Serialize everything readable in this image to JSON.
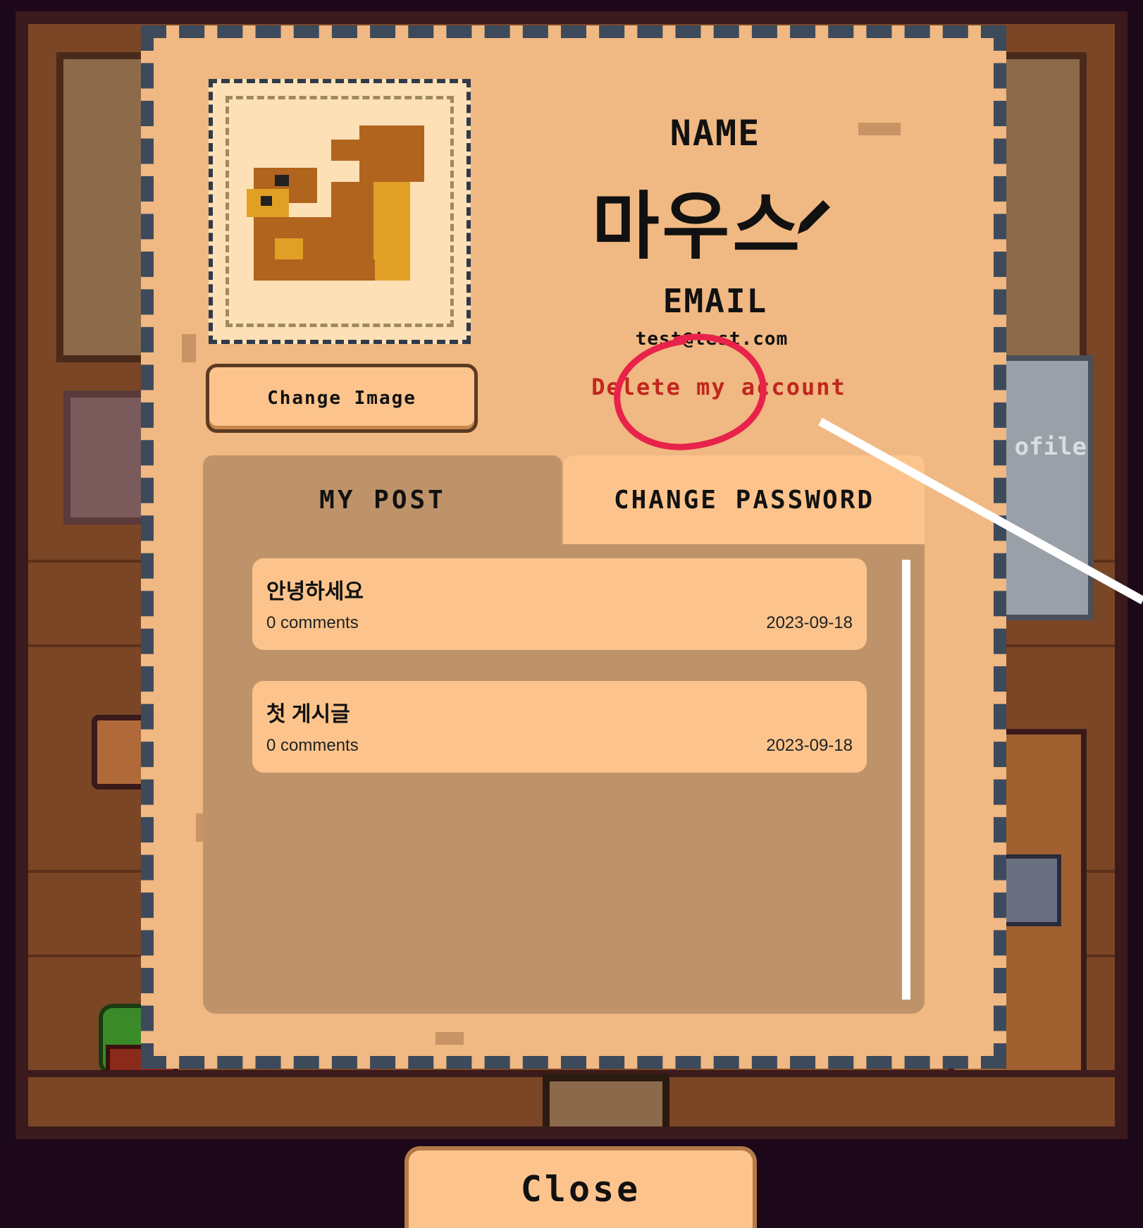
{
  "room": {
    "background_label": "ofile"
  },
  "profile": {
    "name_label": "NAME",
    "name_value": "마우스",
    "email_label": "EMAIL",
    "email_value": "test@test.com",
    "delete_account": "Delete my account",
    "change_image": "Change Image",
    "avatar_icon": "squirrel-icon"
  },
  "tabs": {
    "my_post": "MY POST",
    "change_password": "CHANGE PASSWORD"
  },
  "posts": [
    {
      "title": "안녕하세요",
      "comments": "0 comments",
      "date": "2023-09-18"
    },
    {
      "title": "첫 게시글",
      "comments": "0 comments",
      "date": "2023-09-18"
    }
  ],
  "footer": {
    "close": "Close"
  },
  "colors": {
    "parchment": "#f0b882",
    "tab_active": "#bf936a",
    "tab_inactive": "#fcc48c",
    "danger": "#c0271f",
    "annotation": "#e8224a"
  }
}
